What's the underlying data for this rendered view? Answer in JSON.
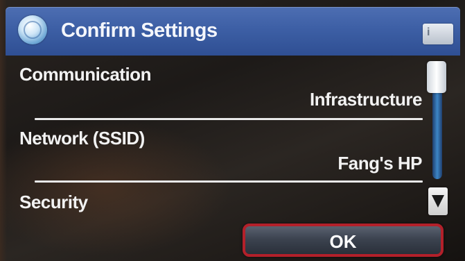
{
  "header": {
    "title": "Confirm Settings",
    "icon": "network-globe-icon",
    "help_label": "i"
  },
  "settings": [
    {
      "label": "Communication",
      "value": "Infrastructure"
    },
    {
      "label": "Network (SSID)",
      "value": "Fang's HP"
    },
    {
      "label": "Security",
      "value": ""
    }
  ],
  "scroll": {
    "up_icon": "scroll-thumb",
    "down_icon": "down-arrow-icon"
  },
  "actions": {
    "ok_label": "OK"
  },
  "colors": {
    "titlebar": "#3d5fa5",
    "background": "#1d1a18",
    "ok_border": "#b3202a",
    "scroll_track": "#3d86c6"
  }
}
